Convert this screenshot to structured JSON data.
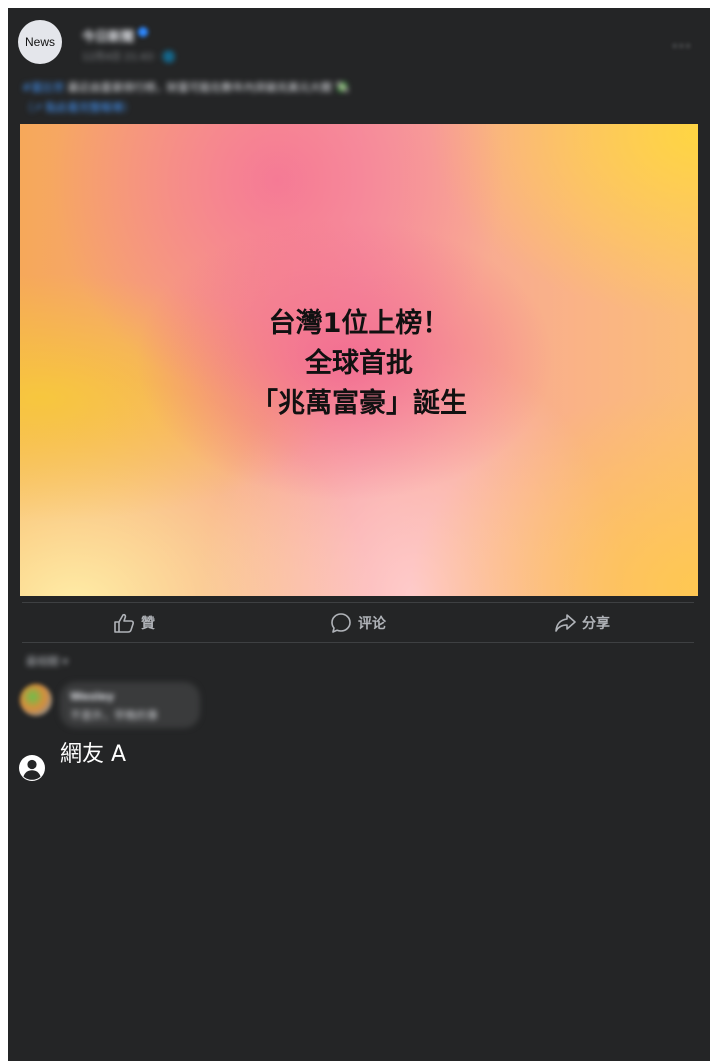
{
  "post": {
    "avatar_text": "News",
    "page_name": "今日新聞",
    "meta": "12月4日 21:43 · 🌐",
    "caption_hashtag": "#富比世",
    "caption_text": " 最近由富豪排行榜，財富可能在數年內突破兆美元大關 💸",
    "caption_link": "（↗ 點此看完整報導）",
    "more_label": "···"
  },
  "hero": {
    "line1": "台灣1位上榜！",
    "line2": "全球首批",
    "line3": "「兆萬富豪」誕生"
  },
  "actions": {
    "like": "贊",
    "comment": "评论",
    "share": "分享"
  },
  "comments": {
    "sort_label": "最相關 ▾",
    "first_name": "Wesley",
    "first_text": "不意外，早晚的事",
    "commenter_name": "網友 A"
  }
}
